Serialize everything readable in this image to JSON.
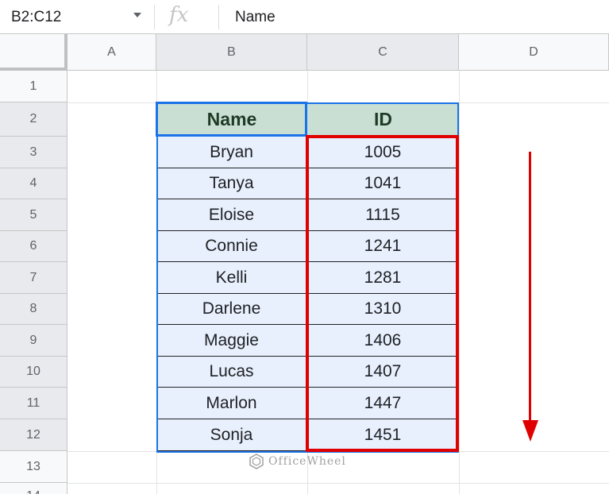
{
  "formula_bar": {
    "name_box": "B2:C12",
    "fx_label": "fx",
    "formula": "Name"
  },
  "columns": [
    "A",
    "B",
    "C",
    "D"
  ],
  "rows": [
    "1",
    "2",
    "3",
    "4",
    "5",
    "6",
    "7",
    "8",
    "9",
    "10",
    "11",
    "12",
    "13",
    "14"
  ],
  "table": {
    "headers": [
      "Name",
      "ID"
    ],
    "rows": [
      [
        "Bryan",
        "1005"
      ],
      [
        "Tanya",
        "1041"
      ],
      [
        "Eloise",
        "1115"
      ],
      [
        "Connie",
        "1241"
      ],
      [
        "Kelli",
        "1281"
      ],
      [
        "Darlene",
        "1310"
      ],
      [
        "Maggie",
        "1406"
      ],
      [
        "Lucas",
        "1407"
      ],
      [
        "Marlon",
        "1447"
      ],
      [
        "Sonja",
        "1451"
      ]
    ]
  },
  "watermark": "OfficeWheel",
  "colors": {
    "header_fill": "#c9dfd3",
    "data_fill": "#e8f0fe",
    "selection": "#1a73e8",
    "annotation": "#e00000"
  }
}
